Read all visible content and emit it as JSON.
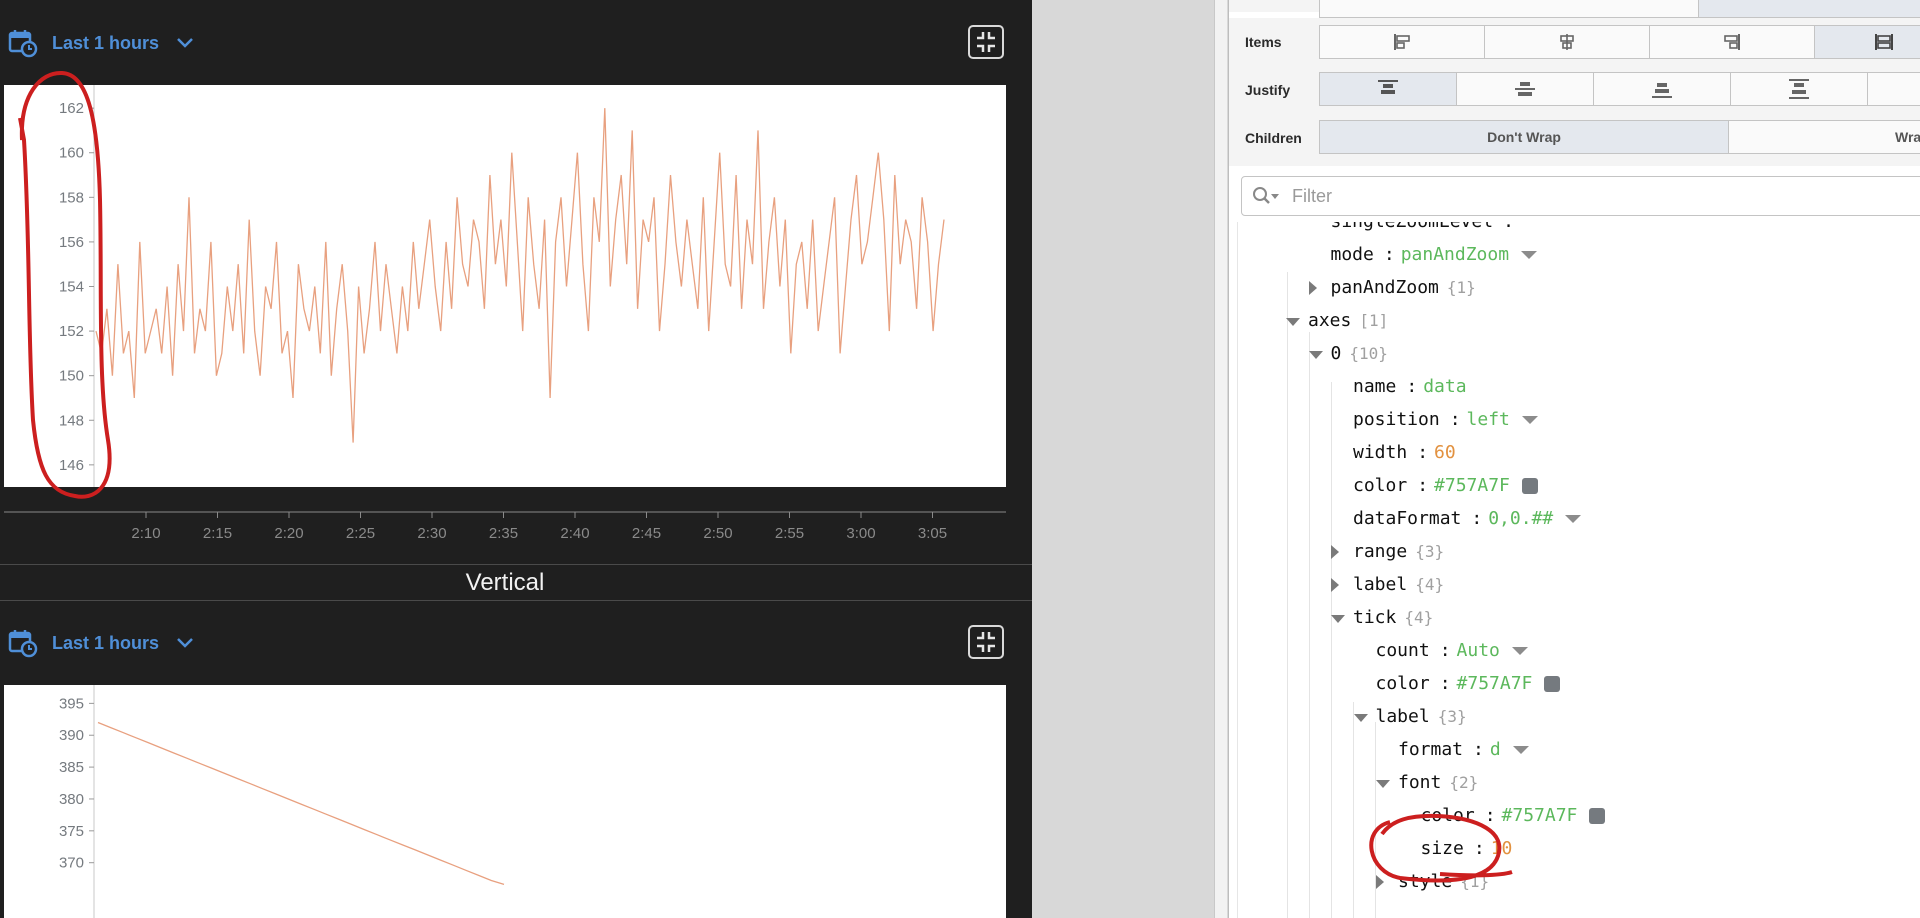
{
  "top_chart": {
    "range_label": "Last 1 hours",
    "y_ticks": [
      "146",
      "148",
      "150",
      "152",
      "154",
      "156",
      "158",
      "160",
      "162"
    ],
    "x_ticks": [
      "2:10",
      "2:15",
      "2:20",
      "2:25",
      "2:30",
      "2:35",
      "2:40",
      "2:45",
      "2:50",
      "2:55",
      "3:00",
      "3:05"
    ]
  },
  "section_title": "Vertical",
  "bottom_chart": {
    "range_label": "Last 1 hours",
    "y_ticks": [
      "370",
      "375",
      "380",
      "385",
      "390",
      "395"
    ]
  },
  "chart_data": [
    {
      "type": "line",
      "xlabel": "",
      "ylabel": "",
      "ylim": [
        145.5,
        162.5
      ],
      "x_range": [
        "2:05",
        "3:07"
      ],
      "series_color": "#E8A07F",
      "series": [
        {
          "values": [
            152,
            151,
            153,
            150,
            155,
            151,
            152,
            149,
            156,
            151,
            152,
            153,
            151,
            154,
            150,
            155,
            152,
            158,
            151,
            153,
            152,
            156,
            150,
            151,
            154,
            152,
            155,
            151,
            157,
            152,
            150,
            154,
            153,
            156,
            151,
            152,
            149,
            155,
            153,
            152,
            154,
            151,
            156,
            150,
            153,
            155,
            152,
            147,
            154,
            151,
            153,
            156,
            152,
            155,
            153,
            151,
            154,
            152,
            156,
            153,
            155,
            157,
            154,
            152,
            156,
            153,
            158,
            155,
            154,
            157,
            156,
            153,
            159,
            155,
            157,
            154,
            160,
            156,
            152,
            158,
            155,
            153,
            157,
            149,
            156,
            158,
            154,
            157,
            160,
            155,
            152,
            158,
            156,
            162,
            154,
            157,
            159,
            155,
            161,
            153,
            157,
            156,
            158,
            152,
            155,
            159,
            156,
            154,
            157,
            155,
            153,
            158,
            152,
            156,
            160,
            155,
            154,
            159,
            153,
            157,
            155,
            161,
            153,
            156,
            158,
            154,
            157,
            151,
            155,
            156,
            153,
            157,
            152,
            154,
            156,
            158,
            151,
            154,
            157,
            159,
            155,
            156,
            158,
            160,
            157,
            152,
            159,
            155,
            157,
            156,
            153,
            158,
            156,
            152,
            155,
            157
          ]
        }
      ]
    },
    {
      "type": "line",
      "xlabel": "",
      "ylabel": "",
      "ylim": [
        366.5,
        396
      ],
      "series_color": "#E8A07F",
      "series": [
        {
          "values": [
            392,
            391.2,
            390.4,
            389.6,
            388.8,
            388,
            387.2,
            386.4,
            385.6,
            384.8,
            384,
            383.2,
            382.4,
            381.6,
            380.8,
            380,
            379.2,
            378.4,
            377.6,
            376.8,
            376,
            375.2,
            374.4,
            373.6,
            372.8,
            372,
            371.2,
            370.4,
            369.6,
            368.8,
            368,
            367.2,
            366.6
          ]
        }
      ]
    }
  ],
  "properties": {
    "items_label": "Items",
    "justify_label": "Justify",
    "children_label": "Children",
    "children_options": [
      "Don't Wrap",
      "Wrap"
    ],
    "filter_placeholder": "Filter",
    "tree": [
      {
        "key": "singleZoomLevel",
        "sep": ":",
        "val": "",
        "depth": 3,
        "partial": true
      },
      {
        "key": "mode",
        "sep": ":",
        "val": "panAndZoom",
        "vtype": "str",
        "dd": true,
        "depth": 3
      },
      {
        "key": "panAndZoom",
        "cnt": "{1}",
        "depth": 3,
        "tog": "closed"
      },
      {
        "key": "axes",
        "cnt": "[1]",
        "depth": 2,
        "tog": "open"
      },
      {
        "key": "0",
        "cnt": "{10}",
        "depth": 3,
        "tog": "open"
      },
      {
        "key": "name",
        "sep": ":",
        "val": "data",
        "vtype": "str",
        "depth": 4
      },
      {
        "key": "position",
        "sep": ":",
        "val": "left",
        "vtype": "str",
        "dd": true,
        "depth": 4
      },
      {
        "key": "width",
        "sep": ":",
        "val": "60",
        "vtype": "num",
        "depth": 4
      },
      {
        "key": "color",
        "sep": ":",
        "val": "#757A7F",
        "vtype": "str",
        "sw": true,
        "depth": 4
      },
      {
        "key": "dataFormat",
        "sep": ":",
        "val": "0,0.##",
        "vtype": "str",
        "dd": true,
        "depth": 4
      },
      {
        "key": "range",
        "cnt": "{3}",
        "depth": 4,
        "tog": "closed"
      },
      {
        "key": "label",
        "cnt": "{4}",
        "depth": 4,
        "tog": "closed"
      },
      {
        "key": "tick",
        "cnt": "{4}",
        "depth": 4,
        "tog": "open"
      },
      {
        "key": "count",
        "sep": ":",
        "val": "Auto",
        "vtype": "str",
        "dd": true,
        "depth": 5
      },
      {
        "key": "color",
        "sep": ":",
        "val": "#757A7F",
        "vtype": "str",
        "sw": true,
        "depth": 5
      },
      {
        "key": "label",
        "cnt": "{3}",
        "depth": 5,
        "tog": "open"
      },
      {
        "key": "format",
        "sep": ":",
        "val": "d",
        "vtype": "str",
        "dd": true,
        "depth": 6
      },
      {
        "key": "font",
        "cnt": "{2}",
        "depth": 6,
        "tog": "open"
      },
      {
        "key": "color",
        "sep": ":",
        "val": "#757A7F",
        "vtype": "str",
        "sw": true,
        "depth": 7
      },
      {
        "key": "size",
        "sep": ":",
        "val": "10",
        "vtype": "num",
        "depth": 7
      },
      {
        "key": "style",
        "cnt": "{1}",
        "depth": 6,
        "tog": "closed"
      }
    ]
  },
  "colors": {
    "accent_blue": "#4F8FD8",
    "series": "#E8A07F",
    "annotation_red": "#CC1F1F",
    "string_value": "#5CB85C",
    "number_value": "#E2913F",
    "swatch": "#757A7F"
  }
}
